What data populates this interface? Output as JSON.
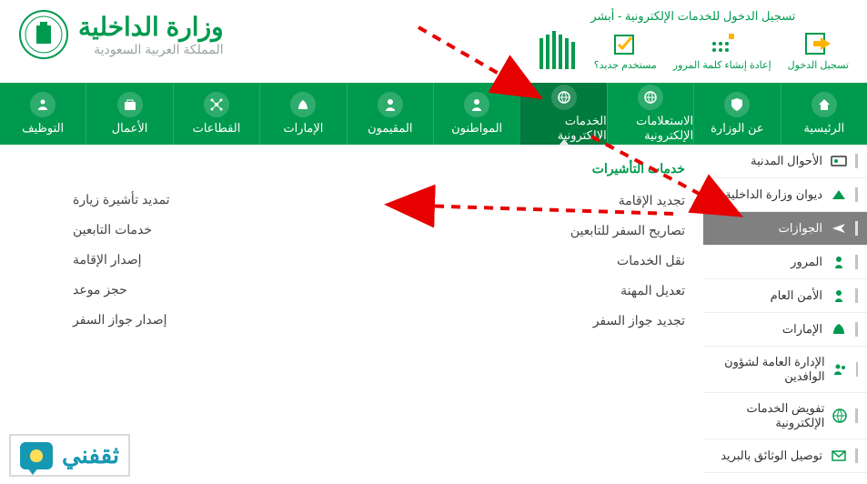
{
  "header": {
    "absher_title": "تسجيل الدخول للخدمات الإلكترونية - أبشر",
    "login": "تسجيل الدخول",
    "reset_pw": "إعادة إنشاء كلمة المرور",
    "new_user": "مستخدم جديد؟"
  },
  "brand": {
    "title": "وزارة الداخلية",
    "subtitle": "المملكة العربية السعودية"
  },
  "nav": {
    "home": "الرئيسية",
    "about": "عن الوزارة",
    "equeries": "الاستعلامات الإلكترونية",
    "eservices": "الخدمات الإلكترونية",
    "citizens": "المواطنون",
    "residents": "المقيمون",
    "emirates": "الإمارات",
    "sectors": "القطاعات",
    "business": "الأعمال",
    "jobs": "التوظيف"
  },
  "sidebar": {
    "items": [
      "الأحوال المدنية",
      "ديوان وزارة الداخلية",
      "الجوازات",
      "المرور",
      "الأمن العام",
      "الإمارات",
      "الإدارة العامة لشؤون الوافدين",
      "تفويض الخدمات الإلكترونية",
      "توصيل الوثائق بالبريد"
    ]
  },
  "panel1": {
    "title": "خدمات التأشيرات",
    "items": [
      "تجديد الإقامة",
      "تصاريح السفر للتابعين",
      "نقل الخدمات",
      "تعديل المهنة",
      "تجديد جواز السفر"
    ]
  },
  "panel2": {
    "items": [
      "تمديد تأشيرة زيارة",
      "خدمات التابعين",
      "إصدار الإقامة",
      "حجز موعد",
      "إصدار جواز السفر"
    ]
  },
  "footer": {
    "brand": "ثقفني"
  }
}
